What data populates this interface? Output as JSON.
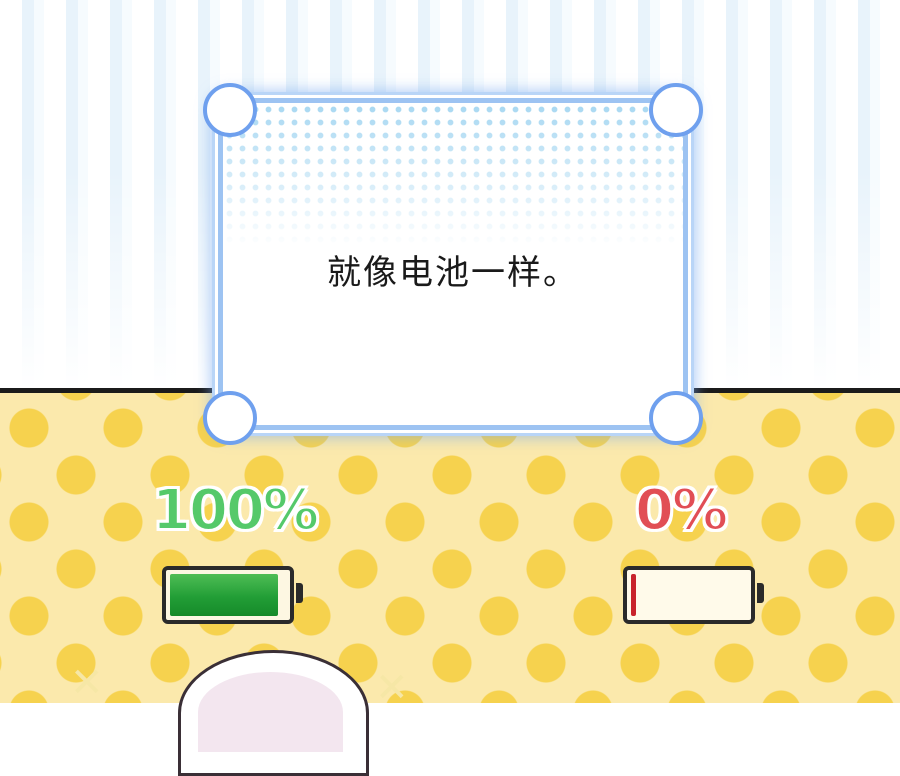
{
  "caption": "就像电池一样。",
  "battery_full": {
    "percent_label": "100%",
    "level": 1.0,
    "color": "#229e36",
    "label_color": "#55c96a"
  },
  "battery_empty": {
    "percent_label": "0%",
    "level": 0.0,
    "color": "#c8232b",
    "label_color": "#e14e55"
  },
  "colors": {
    "panel_border": "#9dc3f2",
    "background_bottom": "#fbe9ac",
    "polka_dot": "#f6d24e"
  }
}
